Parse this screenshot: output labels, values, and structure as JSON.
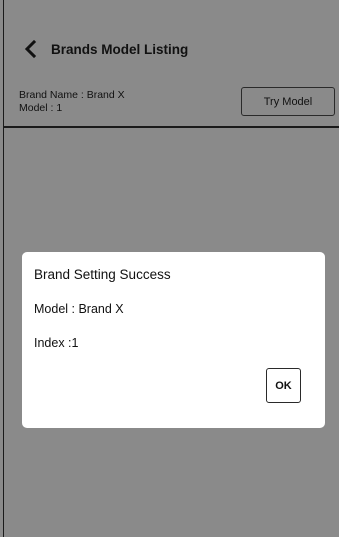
{
  "header": {
    "back_icon": "chevron-left-icon",
    "title": "Brands Model Listing",
    "brand_name_line": "Brand Name : Brand X",
    "model_line": "Model : 1",
    "try_model_label": "Try Model"
  },
  "dialog": {
    "title": "Brand Setting Success",
    "model_line": "Model : Brand X",
    "index_line": "Index :1",
    "ok_label": "OK"
  },
  "colors": {
    "overlay_background": "#8a8a8a",
    "dialog_background": "#ffffff",
    "text": "#111111",
    "divider": "#1a1a1a"
  }
}
